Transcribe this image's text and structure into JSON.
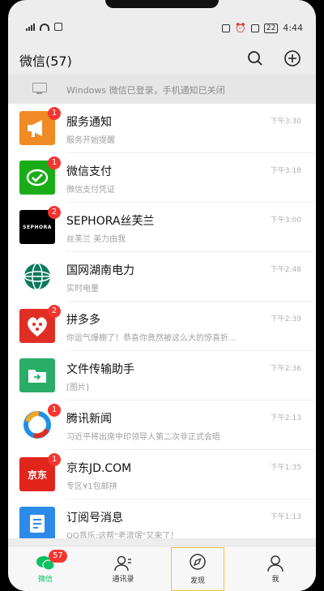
{
  "status_bar": {
    "icons_left": [
      "signal-icon",
      "wifi-icon",
      "notification-icon"
    ],
    "icons_right": [
      "nfc-icon",
      "alarm-icon",
      "vibrate-icon",
      "battery-icon"
    ],
    "battery_label": "22",
    "time": "4:44"
  },
  "header": {
    "title": "微信(57)",
    "search_icon": "search-icon",
    "add_icon": "add-circle-icon"
  },
  "notice": {
    "icon": "monitor-icon",
    "text": "Windows 微信已登录，手机通知已关闭"
  },
  "chats": [
    {
      "name": "服务通知",
      "preview": "服务开始提醒",
      "time": "下午3:30",
      "badge": "1",
      "icon": "megaphone-icon",
      "color": "#f08a24"
    },
    {
      "name": "微信支付",
      "preview": "微信支付凭证",
      "time": "下午3:18",
      "badge": "1",
      "icon": "wechat-pay-icon",
      "color": "#1aad19"
    },
    {
      "name": "SEPHORA丝芙兰",
      "preview": "丝芙兰 美力由我",
      "time": "下午3:00",
      "badge": "2",
      "icon": "sephora-logo",
      "color": "#000000",
      "logo_text": "SEPHORA"
    },
    {
      "name": "国网湖南电力",
      "preview": "实时电量",
      "time": "下午2:48",
      "badge": "",
      "icon": "state-grid-logo",
      "color": "#ffffff"
    },
    {
      "name": "拼多多",
      "preview": "你运气爆棚了！恭喜你竟然被这么大的惊喜折...",
      "time": "下午2:39",
      "badge": "2",
      "icon": "pinduoduo-logo",
      "color": "#e02e24"
    },
    {
      "name": "文件传输助手",
      "preview": "[图片]",
      "time": "下午2:36",
      "badge": "",
      "icon": "folder-icon",
      "color": "#2aae67"
    },
    {
      "name": "腾讯新闻",
      "preview": "习近平将出席中印领导人第二次非正式会晤",
      "time": "下午2:13",
      "badge": "1",
      "icon": "tencent-news-logo",
      "color": "#ffffff"
    },
    {
      "name": "京东JD.COM",
      "preview": "专区¥1包邮拼",
      "time": "下午1:35",
      "badge": "1",
      "icon": "jd-logo",
      "color": "#e1251b",
      "logo_text": "京东"
    },
    {
      "name": "订阅号消息",
      "preview": "QQ音乐:这帮\"老流氓\"又来了！",
      "time": "下午1:13",
      "badge": "",
      "icon": "subscription-icon",
      "color": "#2c8ae8"
    }
  ],
  "tabs": [
    {
      "label": "微信",
      "icon": "chat-bubble-icon",
      "badge": "57",
      "active": true
    },
    {
      "label": "通讯录",
      "icon": "contacts-icon",
      "badge": "",
      "active": false
    },
    {
      "label": "发现",
      "icon": "compass-icon",
      "badge": "",
      "active": false
    },
    {
      "label": "我",
      "icon": "person-icon",
      "badge": "",
      "active": false
    }
  ],
  "colors": {
    "accent": "#07c160",
    "badge": "#f43530"
  }
}
